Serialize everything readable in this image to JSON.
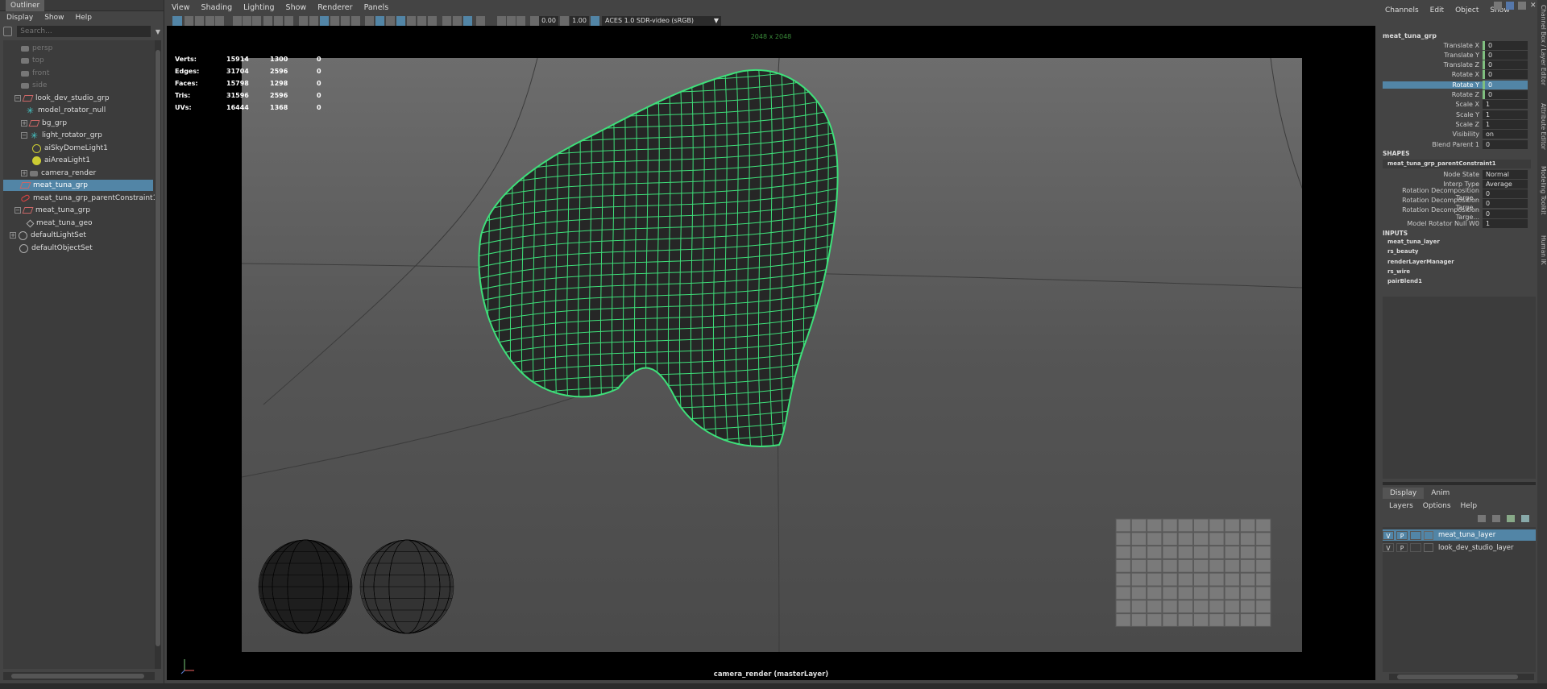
{
  "outliner": {
    "title": "Outliner",
    "menu": [
      "Display",
      "Show",
      "Help"
    ],
    "search_placeholder": "Search...",
    "items": [
      {
        "label": "persp",
        "icon": "camera-icon",
        "dim": true
      },
      {
        "label": "top",
        "icon": "camera-icon",
        "dim": true
      },
      {
        "label": "front",
        "icon": "camera-icon",
        "dim": true
      },
      {
        "label": "side",
        "icon": "camera-icon",
        "dim": true
      },
      {
        "label": "look_dev_studio_grp",
        "icon": "group-icon"
      },
      {
        "label": "model_rotator_null",
        "icon": "locator-icon"
      },
      {
        "label": "bg_grp",
        "icon": "group-icon"
      },
      {
        "label": "light_rotator_grp",
        "icon": "locator-icon"
      },
      {
        "label": "aiSkyDomeLight1",
        "icon": "skydome-light-icon"
      },
      {
        "label": "aiAreaLight1",
        "icon": "area-light-icon"
      },
      {
        "label": "camera_render",
        "icon": "camera-icon"
      },
      {
        "label": "meat_tuna_grp",
        "icon": "group-icon",
        "selected": true
      },
      {
        "label": "meat_tuna_grp_parentConstraint1",
        "icon": "constraint-icon"
      },
      {
        "label": "meat_tuna_grp",
        "icon": "group-icon"
      },
      {
        "label": "meat_tuna_geo",
        "icon": "mesh-icon"
      },
      {
        "label": "defaultLightSet",
        "icon": "set-icon"
      },
      {
        "label": "defaultObjectSet",
        "icon": "set-icon"
      }
    ]
  },
  "viewport": {
    "menu": [
      "View",
      "Shading",
      "Lighting",
      "Show",
      "Renderer",
      "Panels"
    ],
    "exposure": "0.00",
    "gamma": "1.00",
    "color_space": "ACES 1.0 SDR-video (sRGB)",
    "resolution_gate": "2048 x 2048",
    "camera_label": "camera_render (masterLayer)",
    "hud": [
      {
        "label": "Verts:",
        "a": "15914",
        "b": "1300",
        "c": "0"
      },
      {
        "label": "Edges:",
        "a": "31704",
        "b": "2596",
        "c": "0"
      },
      {
        "label": "Faces:",
        "a": "15798",
        "b": "1298",
        "c": "0"
      },
      {
        "label": "Tris:",
        "a": "31596",
        "b": "2596",
        "c": "0"
      },
      {
        "label": "UVs:",
        "a": "16444",
        "b": "1368",
        "c": "0"
      }
    ],
    "wire_color": "#3ee07a"
  },
  "channel_box": {
    "menu": [
      "Channels",
      "Edit",
      "Object",
      "Show"
    ],
    "node": "meat_tuna_grp",
    "channels": [
      {
        "name": "Translate X",
        "value": "0",
        "green": true
      },
      {
        "name": "Translate Y",
        "value": "0",
        "green": true
      },
      {
        "name": "Translate Z",
        "value": "0",
        "green": true
      },
      {
        "name": "Rotate X",
        "value": "0",
        "green": true
      },
      {
        "name": "Rotate Y",
        "value": "0",
        "green": true,
        "selected": true
      },
      {
        "name": "Rotate Z",
        "value": "0",
        "green": true
      },
      {
        "name": "Scale X",
        "value": "1"
      },
      {
        "name": "Scale Y",
        "value": "1"
      },
      {
        "name": "Scale Z",
        "value": "1"
      },
      {
        "name": "Visibility",
        "value": "on"
      },
      {
        "name": "Blend Parent 1",
        "value": "0"
      }
    ],
    "shapes_header": "SHAPES",
    "shape_node": "meat_tuna_grp_parentConstraint1",
    "shape_channels": [
      {
        "name": "Node State",
        "value": "Normal"
      },
      {
        "name": "Interp Type",
        "value": "Average"
      },
      {
        "name": "Rotation Decomposition Targe...",
        "value": "0"
      },
      {
        "name": "Rotation Decomposition Targe...",
        "value": "0"
      },
      {
        "name": "Rotation Decomposition Targe...",
        "value": "0"
      },
      {
        "name": "Model Rotator Null W0",
        "value": "1"
      }
    ],
    "inputs_header": "INPUTS",
    "inputs": [
      "meat_tuna_layer",
      "rs_beauty",
      "renderLayerManager",
      "rs_wire",
      "pairBlend1"
    ]
  },
  "layers": {
    "tabs": [
      "Display",
      "Anim"
    ],
    "menu": [
      "Layers",
      "Options",
      "Help"
    ],
    "items": [
      {
        "v": "V",
        "p": "P",
        "name": "meat_tuna_layer",
        "selected": true
      },
      {
        "v": "V",
        "p": "P",
        "name": "look_dev_studio_layer"
      }
    ]
  },
  "side_tabs": [
    "Channel Box / Layer Editor",
    "Attribute Editor",
    "Modeling Toolkit",
    "Human IK"
  ]
}
